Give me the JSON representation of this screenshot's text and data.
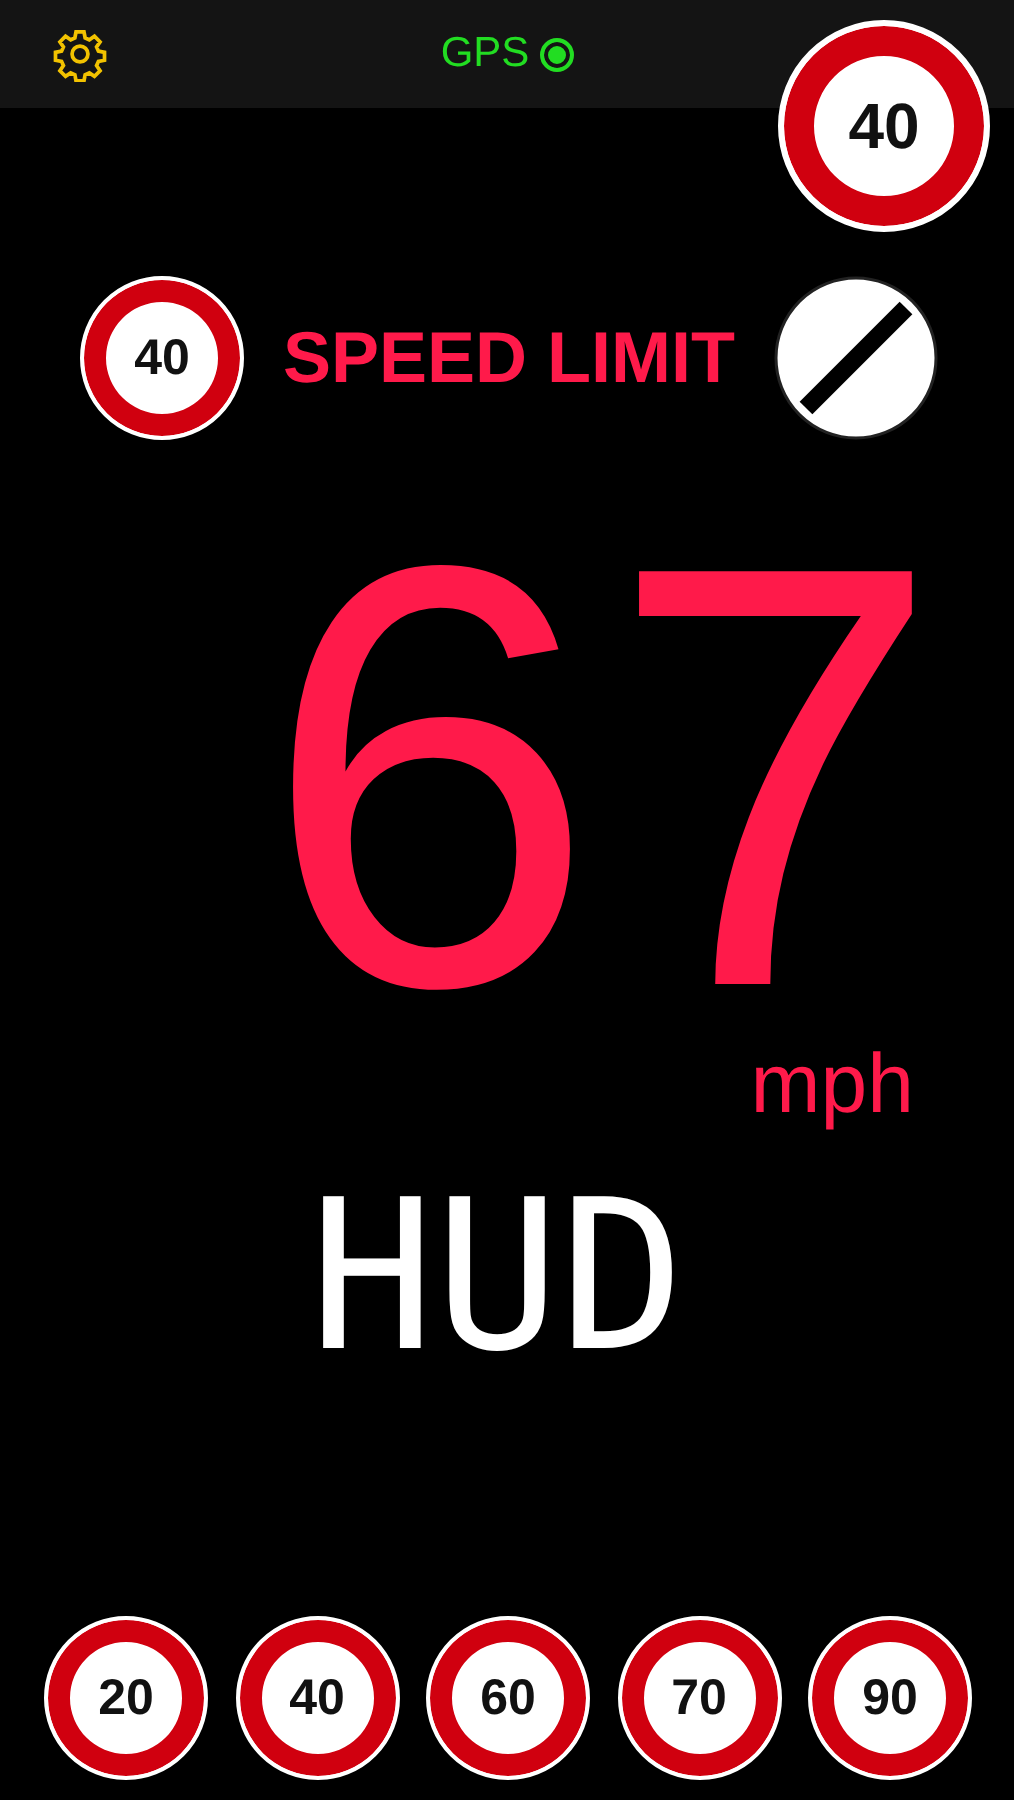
{
  "top_bar": {
    "gps": {
      "label": "GPS",
      "on": true
    }
  },
  "current_limit": {
    "value": "40"
  },
  "speed_limit": {
    "sign": "40",
    "label": "SPEED LIMIT"
  },
  "speed": {
    "value": "67",
    "unit": "mph"
  },
  "mode": {
    "label": "HUD"
  },
  "presets": [
    {
      "value": "20"
    },
    {
      "value": "40"
    },
    {
      "value": "60"
    },
    {
      "value": "70"
    },
    {
      "value": "90"
    }
  ]
}
